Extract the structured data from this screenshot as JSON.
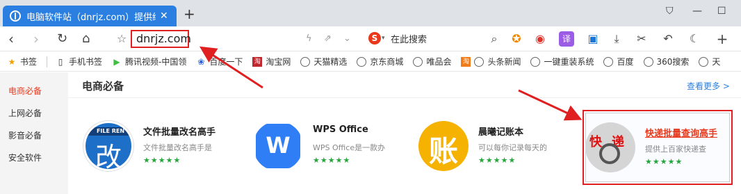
{
  "browser": {
    "tab_title": "电脑软件站（dnrjz.com）提供绿色",
    "tab_close": "✕",
    "new_tab": "+",
    "url": "dnrjz.com",
    "search_placeholder": "在此搜索",
    "search_engine_glyph": "S",
    "toolbar_icons": [
      "game-icon",
      "weibo-icon",
      "translate-icon",
      "screenshot-icon",
      "download-icon",
      "scissors-icon",
      "undo-icon",
      "night-mode-icon",
      "add-icon"
    ]
  },
  "bookmarks": [
    {
      "label": "书签",
      "icon": "star-icon"
    },
    {
      "label": "手机书签",
      "icon": "phone-icon"
    },
    {
      "label": "腾讯视频-中国领",
      "icon": "play-icon"
    },
    {
      "label": "百度一下",
      "icon": "baidu-icon"
    },
    {
      "label": "淘宝网",
      "icon": "taobao-icon"
    },
    {
      "label": "天猫精选",
      "icon": "globe-icon"
    },
    {
      "label": "京东商城",
      "icon": "globe-icon"
    },
    {
      "label": "唯品会",
      "icon": "globe-icon"
    },
    {
      "label": "头条新闻",
      "icon": "globe-icon"
    },
    {
      "label": "一键重装系统",
      "icon": "globe-icon"
    },
    {
      "label": "百度",
      "icon": "globe-icon"
    },
    {
      "label": "360搜索",
      "icon": "globe-icon"
    },
    {
      "label": "天",
      "icon": "globe-icon"
    }
  ],
  "sidenav": [
    "电商必备",
    "上网必备",
    "影音必备",
    "安全软件"
  ],
  "section": {
    "title": "电商必备",
    "more": "查看更多 >"
  },
  "apps": [
    {
      "name": "文件批量改名高手",
      "desc": "文件批量改名高手是",
      "stars": "★★★★★",
      "icon_badge": "FILE REN",
      "icon_glyph": "改"
    },
    {
      "name": "WPS Office",
      "desc": "WPS Office是一款办",
      "stars": "★★★★★",
      "icon_glyph": "W"
    },
    {
      "name": "晨曦记账本",
      "desc": "可以每你记录每天的",
      "stars": "★★★★★",
      "icon_glyph": "账"
    },
    {
      "name": "快递批量查询高手",
      "desc": "提供上百家快递查",
      "stars": "★★★★★",
      "icon_glyph_1": "快",
      "icon_glyph_2": "递"
    }
  ],
  "colors": {
    "accent": "#2a7fe0",
    "annotation_red": "#e02020",
    "active_nav": "#e8391c",
    "stars": "#25a53a"
  }
}
